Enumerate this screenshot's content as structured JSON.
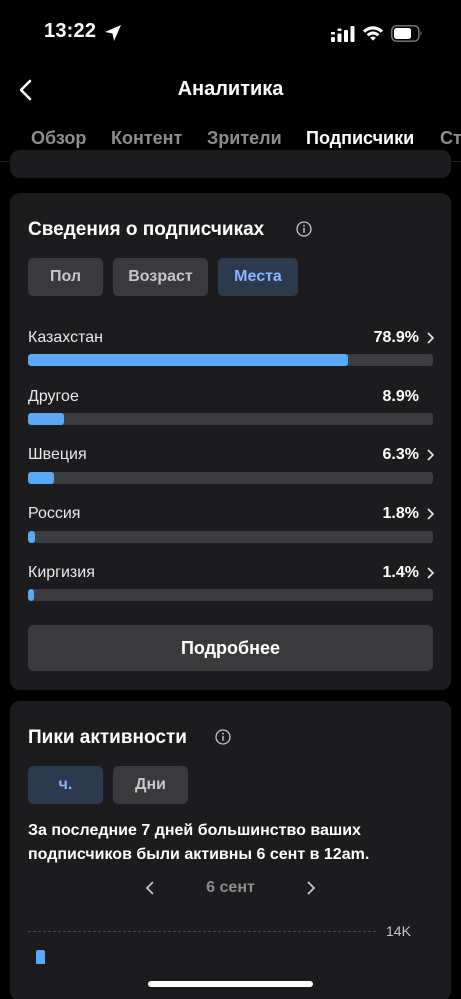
{
  "status_bar": {
    "time": "13:22"
  },
  "nav": {
    "title": "Аналитика"
  },
  "tabs": [
    {
      "label": "Обзор",
      "active": false
    },
    {
      "label": "Контент",
      "active": false
    },
    {
      "label": "Зрители",
      "active": false
    },
    {
      "label": "Подписчики",
      "active": true
    },
    {
      "label": "Ст",
      "active": false
    }
  ],
  "followers": {
    "title": "Сведения о подписчиках",
    "segments": [
      {
        "label": "Пол",
        "selected": false
      },
      {
        "label": "Возраст",
        "selected": false
      },
      {
        "label": "Места",
        "selected": true
      }
    ],
    "locations": [
      {
        "name": "Казахстан",
        "value": "78.9%",
        "percent": 78.9,
        "has_chevron": true
      },
      {
        "name": "Другое",
        "value": "8.9%",
        "percent": 8.9,
        "has_chevron": false
      },
      {
        "name": "Швеция",
        "value": "6.3%",
        "percent": 6.3,
        "has_chevron": true
      },
      {
        "name": "Россия",
        "value": "1.8%",
        "percent": 1.8,
        "has_chevron": true
      },
      {
        "name": "Киргизия",
        "value": "1.4%",
        "percent": 1.4,
        "has_chevron": true
      }
    ],
    "more_label": "Подробнее"
  },
  "activity": {
    "title": "Пики активности",
    "segments": [
      {
        "label": "ч.",
        "selected": true
      },
      {
        "label": "Дни",
        "selected": false
      }
    ],
    "summary": "За последние 7 дней большинство ваших подписчиков были активны 6 сент в 12am.",
    "date": "6 сент",
    "grid_label": "14K"
  },
  "colors": {
    "accent": "#5aa9f5",
    "card": "#1c1c1e",
    "selected_segment_bg": "#2c3a4e",
    "selected_segment_text": "#8ab4ff"
  }
}
